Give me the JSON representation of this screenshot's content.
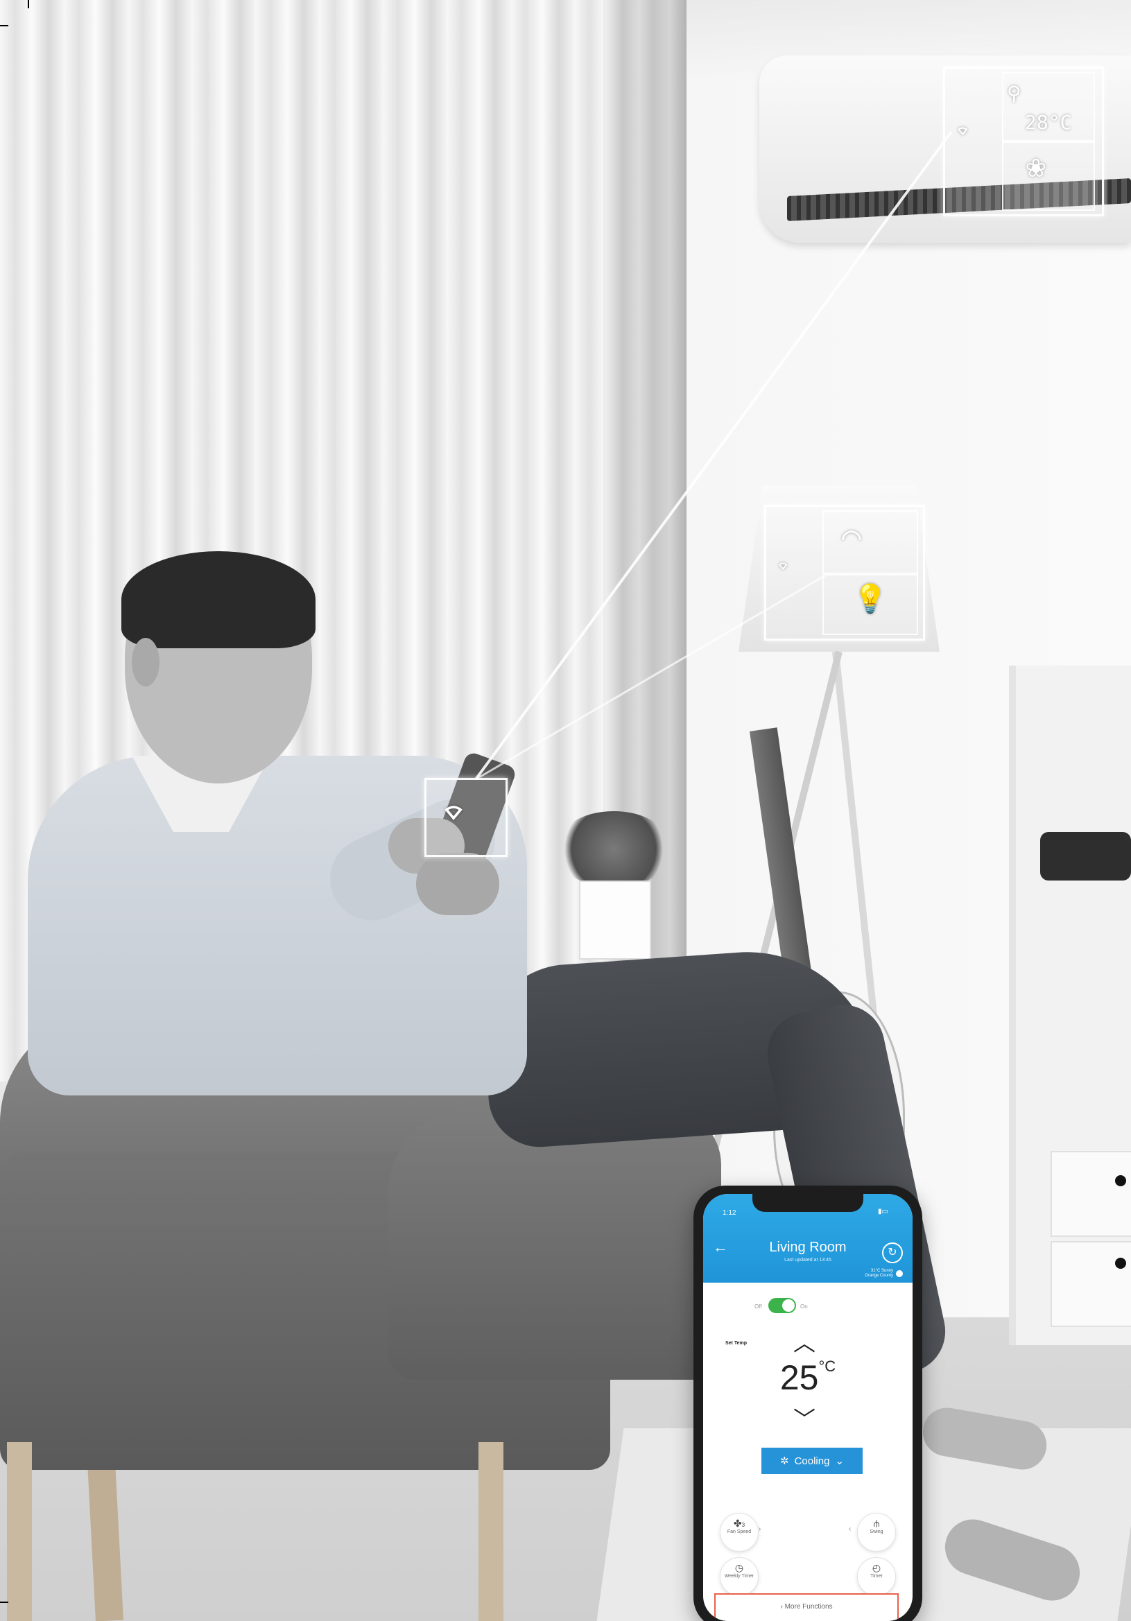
{
  "scene": {
    "description_free": true
  },
  "ac_hologram": {
    "temperature": "28°C",
    "icons": [
      "wifi-icon",
      "thermometer-icon",
      "fan-mode-icon"
    ]
  },
  "lamp_hologram": {
    "icons": [
      "wifi-icon",
      "dimmer-gauge-icon",
      "bulb-icon"
    ]
  },
  "phone_hologram": {
    "icons": [
      "wifi-icon"
    ]
  },
  "app": {
    "status_time": "1:12",
    "title": "Living Room",
    "subtitle": "Last updated at 13:45",
    "weather_line_1": "31°C Sunny",
    "weather_line_2": "Orange County",
    "power": {
      "off_label": "Off",
      "on_label": "On",
      "state": "on"
    },
    "set_temp_label": "Set Temp",
    "set_temp_value": "25",
    "set_temp_unit": "°C",
    "mode_label": "Cooling",
    "functions": [
      {
        "name": "Fan Speed",
        "icon": "fan-icon"
      },
      {
        "name": "Swing",
        "icon": "swing-icon"
      },
      {
        "name": "Weekly Timer",
        "icon": "weekly-timer-icon"
      },
      {
        "name": "Timer",
        "icon": "timer-icon"
      }
    ],
    "fan_speed_value": "3",
    "more_functions_label": "More Functions",
    "colors": {
      "header": "#2fa9e6",
      "toggle_on": "#3cb24a",
      "mode_button": "#2693d9",
      "more_border": "#e9604a"
    }
  }
}
